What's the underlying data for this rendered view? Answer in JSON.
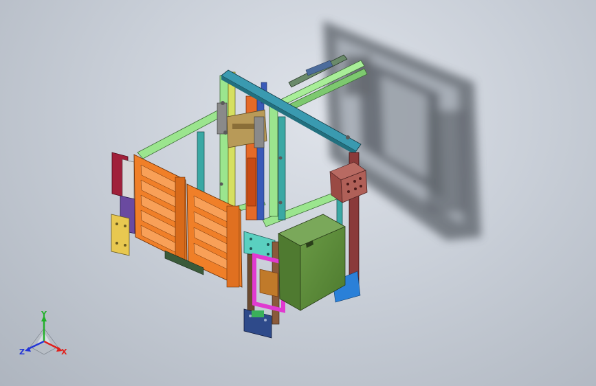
{
  "viewport": {
    "background_top": "#e0e4ea",
    "background_bottom": "#aab1bb"
  },
  "triad": {
    "x_label": "X",
    "y_label": "Y",
    "z_label": "Z",
    "x_color": "#e0201c",
    "y_color": "#22b02a",
    "z_color": "#2436d6"
  },
  "colors": {
    "light_green": "#9be58e",
    "teal": "#3aa8a4",
    "orange": "#f07f28",
    "dark_orange": "#c65f12",
    "maroon": "#8a3a3a",
    "olive_green": "#5e8a3c",
    "magenta": "#e03ad0",
    "navy": "#2e4a8a",
    "yellow": "#e8c850",
    "crimson": "#a0203a",
    "blue": "#2a70c8",
    "purple": "#6a4aa0"
  }
}
